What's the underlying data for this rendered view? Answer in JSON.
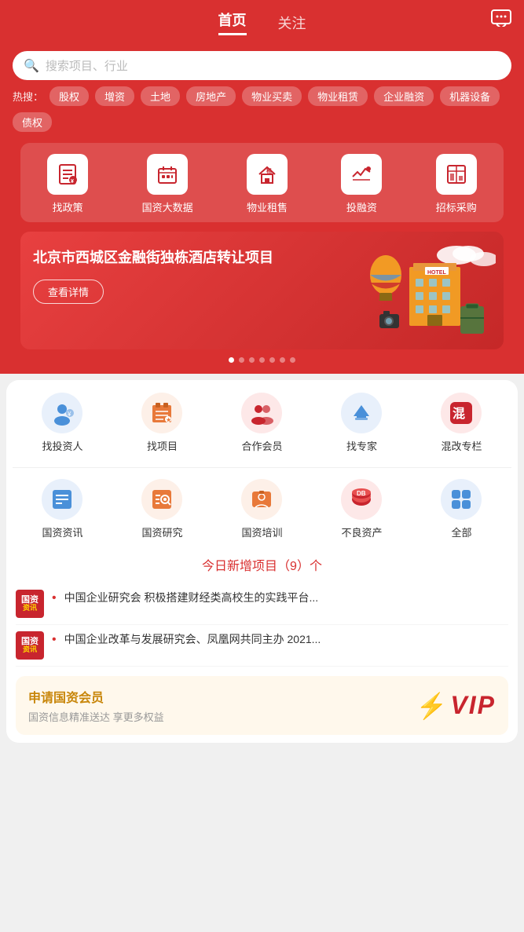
{
  "header": {
    "tab_home": "首页",
    "tab_follow": "关注",
    "message_icon": "💬"
  },
  "search": {
    "placeholder": "搜索项目、行业",
    "hot_label": "热搜："
  },
  "hot_tags": [
    "股权",
    "增资",
    "土地",
    "房地产",
    "物业买卖",
    "物业租赁",
    "企业融资",
    "机器设备",
    "债权"
  ],
  "top_menu": [
    {
      "label": "找政策",
      "icon": "📋"
    },
    {
      "label": "国资大数据",
      "icon": "🏠"
    },
    {
      "label": "物业租售",
      "icon": "🏡"
    },
    {
      "label": "投融资",
      "icon": "🏛️"
    },
    {
      "label": "招标采购",
      "icon": "📰"
    }
  ],
  "banner": {
    "title": "北京市西城区金融街独栋酒店转让项目",
    "button": "查看详情",
    "dots": [
      true,
      false,
      false,
      false,
      false,
      false,
      false
    ]
  },
  "second_menu": [
    {
      "label": "找投资人",
      "icon": "👤",
      "color": "#4a90d9"
    },
    {
      "label": "找项目",
      "icon": "📁",
      "color": "#e8793a"
    },
    {
      "label": "合作会员",
      "icon": "👥",
      "color": "#c8252e"
    },
    {
      "label": "找专家",
      "icon": "🎓",
      "color": "#4a90d9"
    },
    {
      "label": "混改专栏",
      "icon": "🏷️",
      "color": "#c8252e"
    }
  ],
  "third_menu": [
    {
      "label": "国资资讯",
      "icon": "📰",
      "color": "#4a90d9"
    },
    {
      "label": "国资研究",
      "icon": "📑",
      "color": "#e8793a"
    },
    {
      "label": "国资培训",
      "icon": "🎭",
      "color": "#e8793a"
    },
    {
      "label": "不良资产",
      "icon": "🗄️",
      "color": "#c8252e"
    },
    {
      "label": "全部",
      "icon": "⬛",
      "color": "#4a90d9"
    }
  ],
  "today_new": "今日新增项目（9）个",
  "news_items": [
    {
      "badge_top": "国资",
      "badge_bottom": "资讯",
      "dot": "•",
      "text": "中国企业研究会 积极搭建财经类高校生的实践平台..."
    },
    {
      "badge_top": "国资",
      "badge_bottom": "资讯",
      "dot": "•",
      "text": "中国企业改革与发展研究会、凤凰网共同主办 2021..."
    }
  ],
  "vip": {
    "title": "申请国资会员",
    "subtitle": "国资信息精准送达 享更多权益",
    "vip_text": "VIP"
  }
}
